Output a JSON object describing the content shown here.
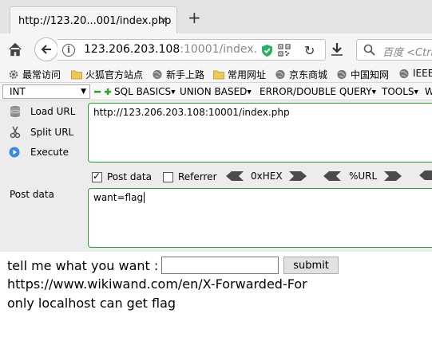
{
  "tab": {
    "title": "http://123.20...001/index.php",
    "close": "×",
    "new_tab": "+"
  },
  "address": {
    "host": "123.206.203.108",
    "rest": ":10001/index."
  },
  "search": {
    "placeholder": "百度 <Ctrl"
  },
  "bookmarks": [
    {
      "label": "最常访问",
      "icon": "gear-icon"
    },
    {
      "label": "火狐官方站点",
      "icon": "folder-icon"
    },
    {
      "label": "新手上路",
      "icon": "globe-icon"
    },
    {
      "label": "常用网址",
      "icon": "folder-icon"
    },
    {
      "label": "京东商城",
      "icon": "globe-icon"
    },
    {
      "label": "中国知网",
      "icon": "globe-icon"
    },
    {
      "label": "IEEE",
      "icon": "globe-icon"
    }
  ],
  "hackbar": {
    "select_value": "INT",
    "menus": [
      "SQL BASICS",
      "UNION BASED",
      "ERROR/DOUBLE QUERY",
      "TOOLS",
      "W"
    ],
    "side": {
      "load_url": "Load URL",
      "split_url": "Split URL",
      "execute": "Execute",
      "post_data_label": "Post data"
    },
    "url_value": "http://123.206.203.108:10001/index.php",
    "options": {
      "post_data": "Post data",
      "post_data_checked": true,
      "referrer": "Referrer",
      "referrer_checked": false,
      "hex": "0xHEX",
      "url_enc": "%URL"
    },
    "post_value": "want=flag"
  },
  "page": {
    "prompt": "tell me what you want :",
    "input_value": "",
    "submit": "submit",
    "line2": "https://www.wikiwand.com/en/X-Forwarded-For",
    "line3": "only localhost can get flag"
  },
  "colors": {
    "accent_green": "#28a428",
    "shield_green": "#2bae66"
  }
}
